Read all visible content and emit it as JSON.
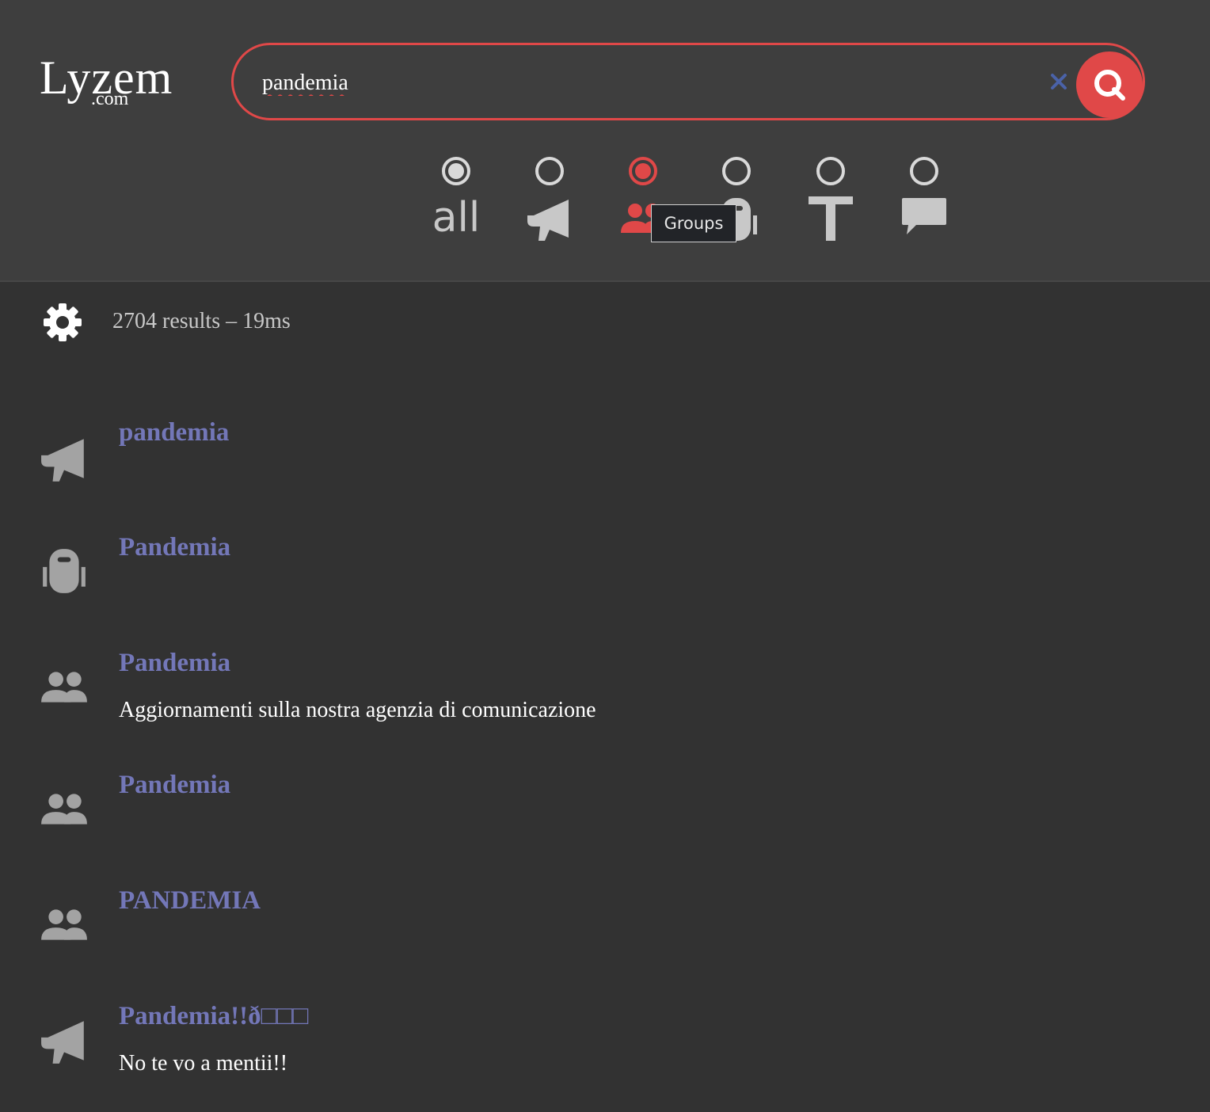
{
  "logo": {
    "main": "Lyzem",
    "sub": ".com"
  },
  "search": {
    "query": "pandemia"
  },
  "filters": [
    {
      "id": "all",
      "label": "all",
      "icon": "all-text"
    },
    {
      "id": "channels",
      "icon": "megaphone-icon"
    },
    {
      "id": "groups",
      "icon": "group-icon",
      "selected": true
    },
    {
      "id": "bots",
      "icon": "robot-icon"
    },
    {
      "id": "text",
      "icon": "text-icon"
    },
    {
      "id": "messages",
      "icon": "chat-bubble-icon"
    }
  ],
  "tooltip": {
    "text": "Groups"
  },
  "stats": {
    "text": "2704 results – 19ms"
  },
  "results": [
    {
      "type": "channel",
      "icon": "megaphone-icon",
      "title": "pandemia",
      "description": ""
    },
    {
      "type": "bot",
      "icon": "robot-icon",
      "title": "Pandemia",
      "description": ""
    },
    {
      "type": "group",
      "icon": "group-icon",
      "title": "Pandemia",
      "description": "Aggiornamenti sulla nostra agenzia di comunicazione"
    },
    {
      "type": "group",
      "icon": "group-icon",
      "title": "Pandemia",
      "description": ""
    },
    {
      "type": "group",
      "icon": "group-icon",
      "title": "PANDEMIA",
      "description": ""
    },
    {
      "type": "channel",
      "icon": "megaphone-icon",
      "title": "Pandemia!!ð□□□",
      "description": "No te vo a mentii!!"
    }
  ],
  "colors": {
    "accent": "#e04848",
    "link": "#7377b8",
    "icon_gray": "#a3a3a3",
    "header_bg": "#3e3e3e",
    "page_bg": "#323232",
    "clear_x": "#4a62a8"
  }
}
